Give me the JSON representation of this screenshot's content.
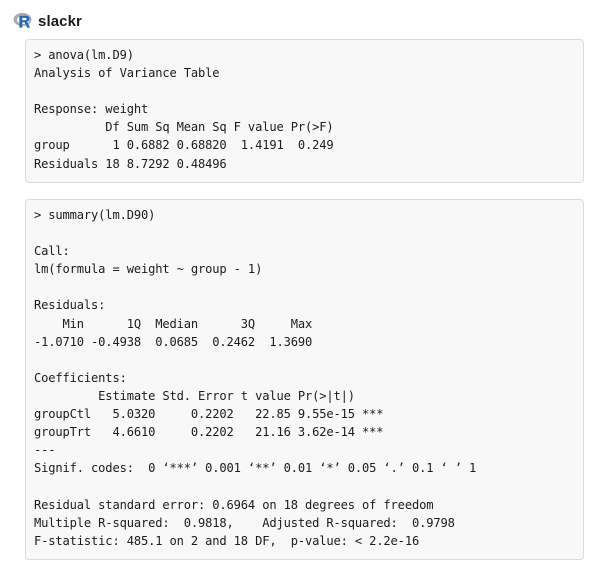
{
  "message": {
    "sender": "slackr",
    "avatar_icon": "r-logo-icon"
  },
  "colors": {
    "code_background": "#f8f8f8",
    "code_border": "#dcdcdc",
    "text": "#1d1c1d",
    "logo_blue": "#2266b8",
    "logo_grey": "#9a9ea6"
  },
  "code_blocks": [
    {
      "lines": [
        "> anova(lm.D9)",
        "Analysis of Variance Table",
        "",
        "Response: weight",
        "          Df Sum Sq Mean Sq F value Pr(>F)",
        "group      1 0.6882 0.68820  1.4191  0.249",
        "Residuals 18 8.7292 0.48496"
      ]
    },
    {
      "lines": [
        "> summary(lm.D90)",
        "",
        "Call:",
        "lm(formula = weight ~ group - 1)",
        "",
        "Residuals:",
        "    Min      1Q  Median      3Q     Max",
        "-1.0710 -0.4938  0.0685  0.2462  1.3690",
        "",
        "Coefficients:",
        "         Estimate Std. Error t value Pr(>|t|)",
        "groupCtl   5.0320     0.2202   22.85 9.55e-15 ***",
        "groupTrt   4.6610     0.2202   21.16 3.62e-14 ***",
        "---",
        "Signif. codes:  0 ‘***’ 0.001 ‘**’ 0.01 ‘*’ 0.05 ‘.’ 0.1 ‘ ’ 1",
        "",
        "Residual standard error: 0.6964 on 18 degrees of freedom",
        "Multiple R-squared:  0.9818,    Adjusted R-squared:  0.9798",
        "F-statistic: 485.1 on 2 and 18 DF,  p-value: < 2.2e-16"
      ]
    }
  ]
}
